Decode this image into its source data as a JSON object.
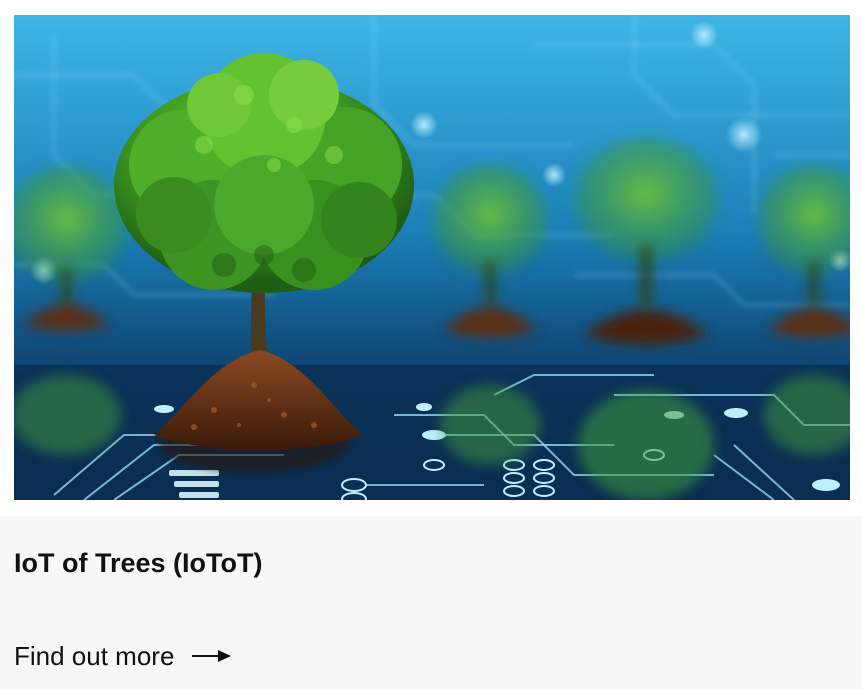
{
  "card": {
    "image_alt": "Tree growing from soil on a circuit board",
    "title": "IoT of Trees (IoToT)",
    "link_label": "Find out more",
    "link_icon": "arrow-right-icon"
  },
  "colors": {
    "content_background": "#f7f7f7",
    "text": "#111111",
    "circuit_blue": "#1a9fd6",
    "tree_green": "#3fa32a",
    "soil_brown": "#5a2e16"
  }
}
